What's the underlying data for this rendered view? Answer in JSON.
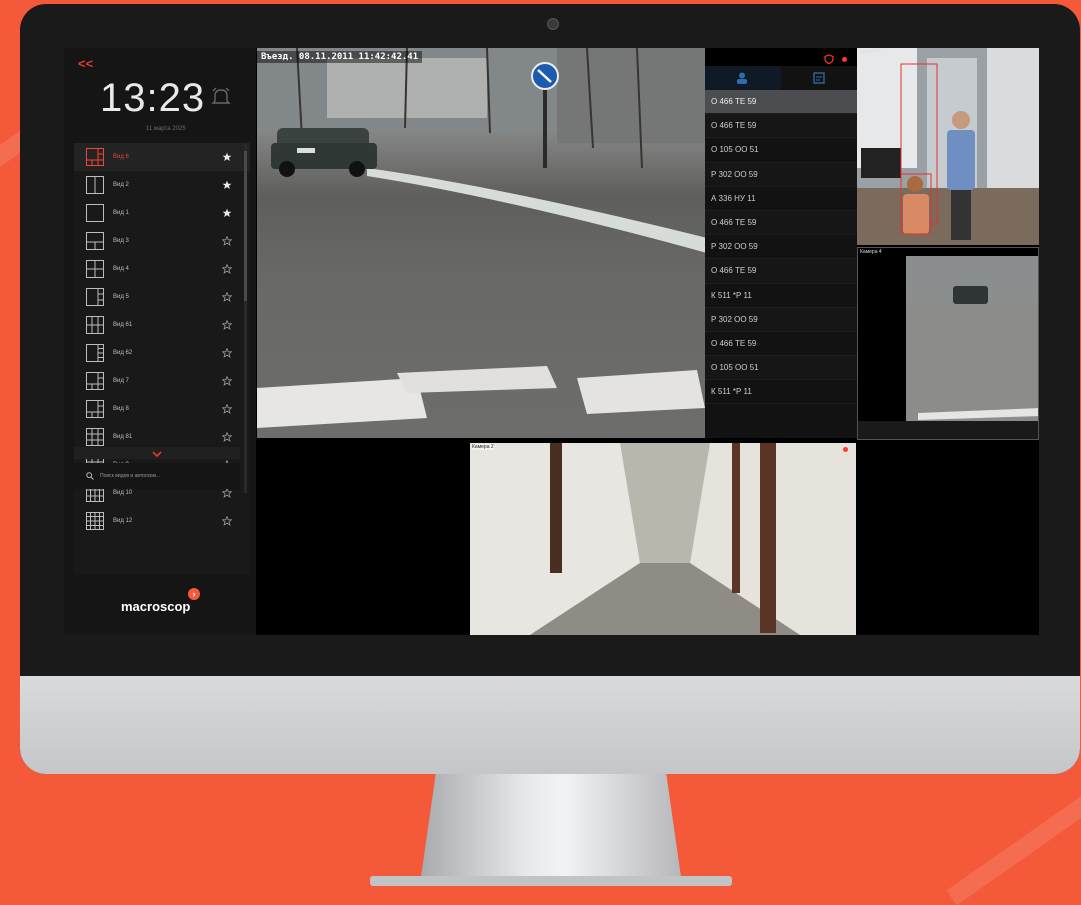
{
  "app": {
    "brand": "macroscop",
    "collapse_label": "<<",
    "clock": "13:23",
    "date": "11 марта 2025"
  },
  "views": [
    {
      "label": "Вид 6",
      "grid": "1+5",
      "favorite": true,
      "active": true
    },
    {
      "label": "Вид 2",
      "grid": "2",
      "favorite": true
    },
    {
      "label": "Вид 1",
      "grid": "1",
      "favorite": true
    },
    {
      "label": "Вид 3",
      "grid": "1+2",
      "favorite": false
    },
    {
      "label": "Вид 4",
      "grid": "2x2",
      "favorite": false
    },
    {
      "label": "Вид 5",
      "grid": "1+3",
      "favorite": false
    },
    {
      "label": "Вид 61",
      "grid": "3x2",
      "favorite": false
    },
    {
      "label": "Вид 62",
      "grid": "1+4",
      "favorite": false
    },
    {
      "label": "Вид 7",
      "grid": "1+7",
      "favorite": false
    },
    {
      "label": "Вид 8",
      "grid": "1+8",
      "favorite": false
    },
    {
      "label": "Вид 81",
      "grid": "3x3",
      "favorite": false
    },
    {
      "label": "Вид 9",
      "grid": "3x3",
      "favorite": false
    },
    {
      "label": "Вид 10",
      "grid": "4x3",
      "favorite": false
    },
    {
      "label": "Вид 12",
      "grid": "4x4",
      "favorite": false
    }
  ],
  "search": {
    "placeholder": "Поиск видов и автоском..."
  },
  "main_camera": {
    "timestamp": "Въезд. 08.11.2011 11:42:42.41"
  },
  "plates": [
    "О 466 ТЕ 59",
    "О 466 ТЕ 59",
    "О 105 ОО 51",
    "Р 302 ОО 59",
    "А 336 НУ 11",
    "О 466 ТЕ 59",
    "Р 302 ОО 59",
    "О 466 ТЕ 59",
    "К 511 *Р 11",
    "Р 302 ОО 59",
    "О 466 ТЕ 59",
    "О 105 ОО 51",
    "К 511 *Р 11"
  ],
  "cameras": {
    "cam5": "Камера 5",
    "cam4": "Камера 4",
    "cam2": "Камера 2"
  },
  "colors": {
    "accent": "#f4593a",
    "alert": "#e23b2a",
    "tab_active": "#2e6ea8"
  },
  "icons": [
    "alarm-icon",
    "user-icon",
    "note-icon",
    "shield-icon",
    "search-icon",
    "star-icon",
    "chevron-down-icon"
  ]
}
